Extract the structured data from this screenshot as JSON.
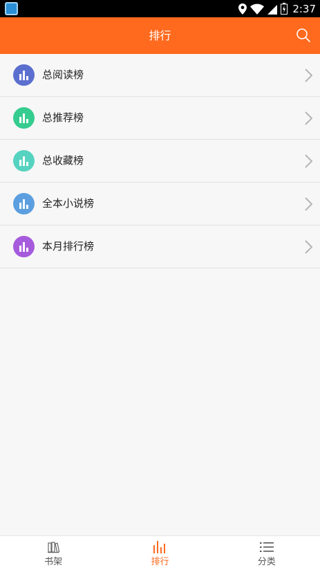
{
  "status_bar": {
    "time": "2:37"
  },
  "app_bar": {
    "title": "排行"
  },
  "rankings": [
    {
      "label": "总阅读榜",
      "color": "#5b6fcf"
    },
    {
      "label": "总推荐榜",
      "color": "#35cc8f"
    },
    {
      "label": "总收藏榜",
      "color": "#56d3c0"
    },
    {
      "label": "全本小说榜",
      "color": "#5b9fe0"
    },
    {
      "label": "本月排行榜",
      "color": "#a55bdb"
    }
  ],
  "bottom_nav": [
    {
      "label": "书架",
      "icon": "bookshelf-icon",
      "active": false
    },
    {
      "label": "排行",
      "icon": "ranking-icon",
      "active": true
    },
    {
      "label": "分类",
      "icon": "category-list-icon",
      "active": false
    }
  ],
  "colors": {
    "accent": "#ff6a1e"
  }
}
